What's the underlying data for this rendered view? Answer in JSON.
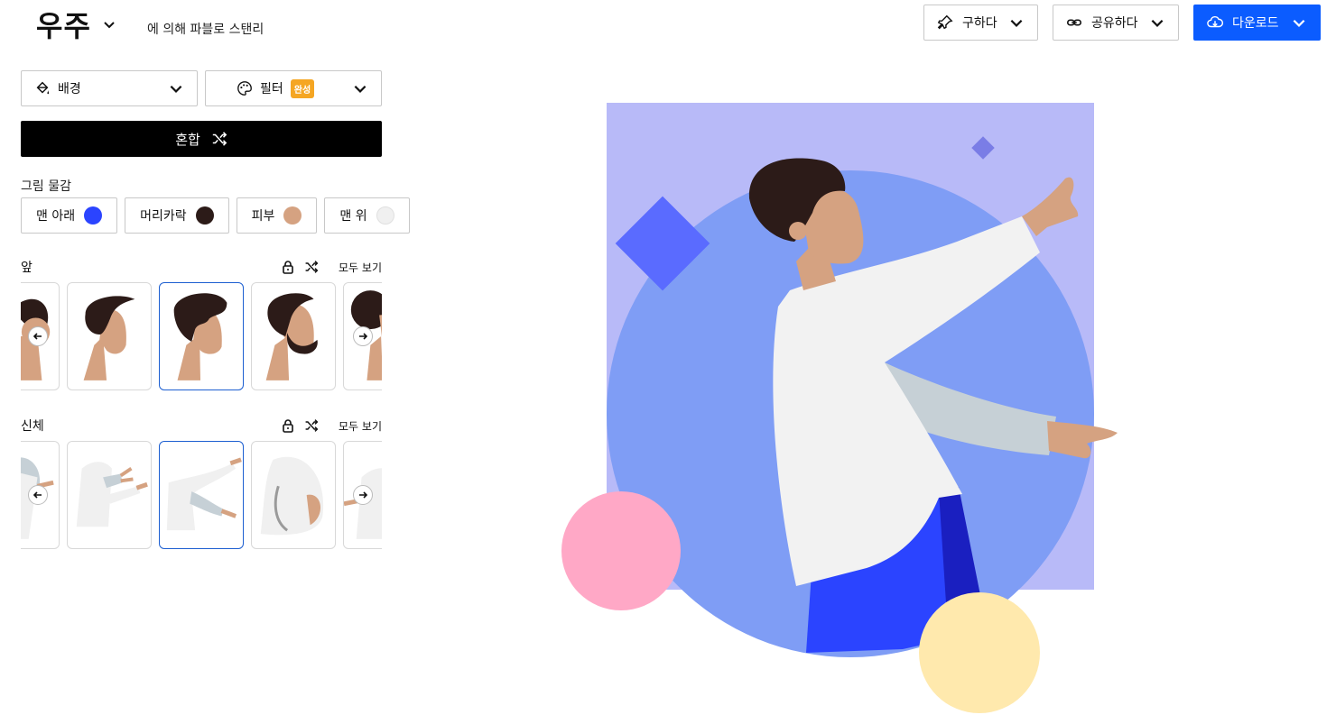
{
  "header": {
    "title": "우주",
    "byline": "에 의해 파블로 스탠리",
    "save_label": "구하다",
    "share_label": "공유하다",
    "download_label": "다운로드"
  },
  "controls": {
    "background_label": "배경",
    "filter_label": "필터",
    "filter_badge": "완성",
    "mix_label": "혼합"
  },
  "colors_section": {
    "label": "그림 물감",
    "swatches": [
      {
        "label": "맨 아래",
        "color": "#2b44ff"
      },
      {
        "label": "머리카락",
        "color": "#2c1b18"
      },
      {
        "label": "피부",
        "color": "#d5a281"
      },
      {
        "label": "맨 위",
        "color": "#f0f0f0"
      }
    ]
  },
  "front_section": {
    "label": "앞",
    "see_all": "모두 보기"
  },
  "body_section": {
    "label": "신체",
    "see_all": "모두 보기"
  },
  "palette": {
    "primary": "#0b5cff",
    "bg_square": "#b8baf8",
    "big_circle": "#7f9df5",
    "diamond": "#5a6bff",
    "pink_circle": "#ffa8c6",
    "yellow_circle": "#ffe9ad"
  }
}
